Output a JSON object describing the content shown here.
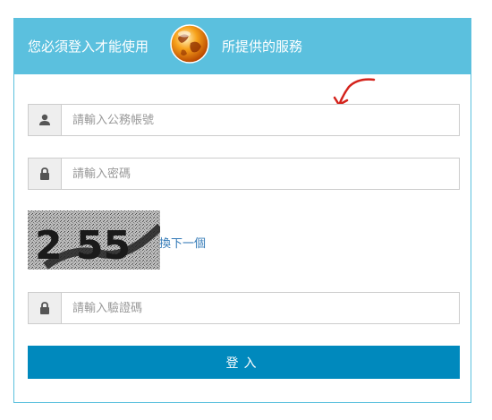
{
  "header": {
    "text_left": "您必須登入才能使用",
    "text_right": "所提供的服務",
    "logo_icon": "globe-icon",
    "bg_color": "#5bc0de"
  },
  "form": {
    "account": {
      "icon": "user-icon",
      "placeholder": "請輸入公務帳號",
      "value": ""
    },
    "password": {
      "icon": "lock-icon",
      "placeholder": "請輸入密碼",
      "value": ""
    },
    "captcha": {
      "image_text": "2 55",
      "refresh_label": "換下一個"
    },
    "verify": {
      "icon": "lock-icon",
      "placeholder": "請輸入驗證碼",
      "value": ""
    },
    "submit_label": "登入",
    "submit_color": "#0089bd"
  }
}
